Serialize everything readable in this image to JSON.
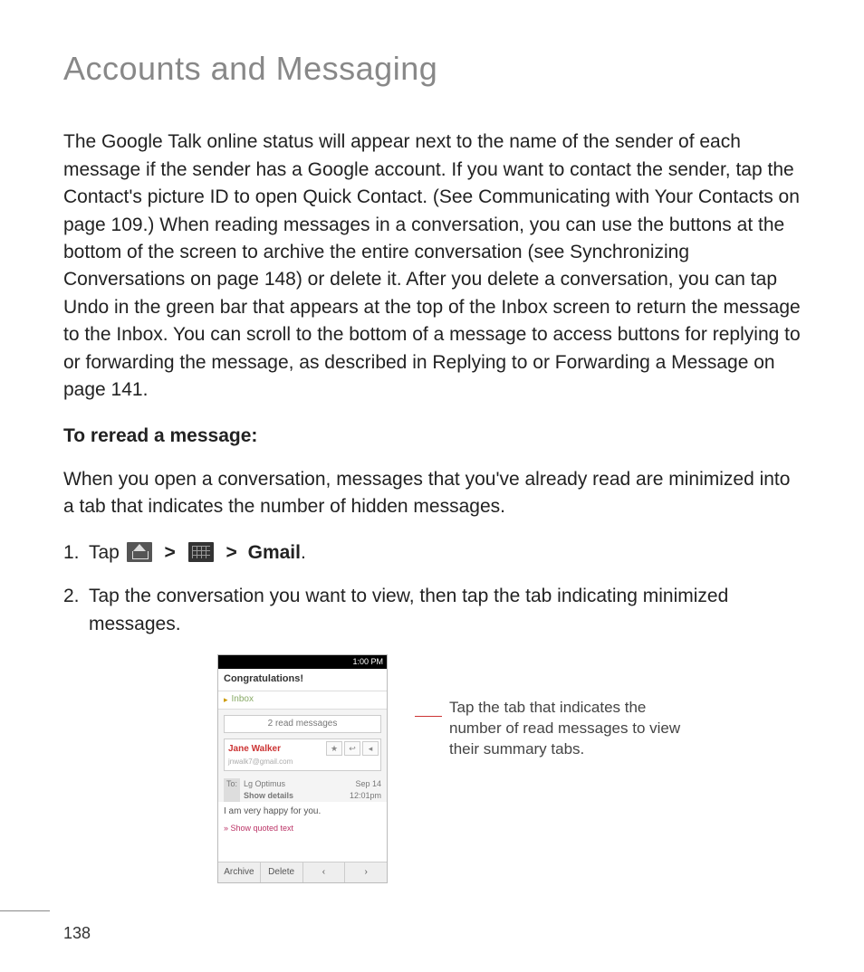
{
  "page_title": "Accounts and Messaging",
  "paragraph_main": "The Google Talk online status will appear next to the name of the sender of each message if the sender has a Google account. If you want to contact the sender, tap the Contact's picture ID to open Quick Contact. (See Communicating with Your Contacts on page 109.) When reading messages in a conversation, you can use the buttons at the bottom of the screen to archive the entire conversation (see Synchronizing Conversations on page 148) or delete it. After you delete a conversation, you can tap Undo in the green bar that appears at the top of the Inbox screen to return the message to the Inbox. You can scroll to the bottom of a message to access buttons for replying to or forwarding the message, as described in Replying to or Forwarding a Message on page 141.",
  "subhead": "To reread a message:",
  "paragraph_sub": "When you open a conversation, messages that you've already read are minimized into a tab that indicates the number of hidden messages.",
  "steps": {
    "s1_num": "1.",
    "s1_pre": "Tap ",
    "s1_sep": ">",
    "s1_gmail": "Gmail",
    "s1_end": ".",
    "s2_num": "2.",
    "s2_text": "Tap the conversation you want to view, then tap the tab indicating minimized messages."
  },
  "screenshot": {
    "status_time": "1:00 PM",
    "title": "Congratulations!",
    "inbox": "Inbox",
    "read_tab": "2 read messages",
    "sender_name": "Jane Walker",
    "sender_mail": "jnwalk7@gmail.com",
    "btn_star": "★",
    "btn_reply": "↩",
    "btn_more": "◂",
    "to_label": "To:",
    "to_value": "Lg Optimus",
    "show_details": "Show details",
    "date": "Sep 14",
    "time": "12:01pm",
    "body": "I am very happy for you.",
    "quoted": "» Show quoted text",
    "archive": "Archive",
    "delete": "Delete",
    "prev": "‹",
    "next": "›"
  },
  "callout": "Tap the tab that indicates the number of read messages to view their summary tabs.",
  "page_number": "138"
}
